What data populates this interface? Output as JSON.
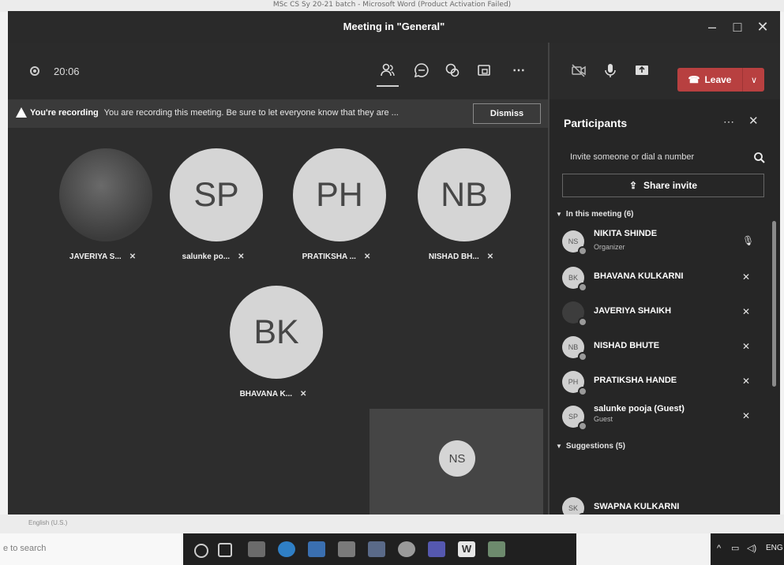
{
  "word": {
    "title": "MSc CS Sy 20-21 batch - Microsoft Word (Product Activation Failed)",
    "language": "English (U.S.)"
  },
  "window": {
    "title": "Meeting in \"General\""
  },
  "controls": {
    "timer": "20:06",
    "leave_label": "Leave"
  },
  "recording_banner": {
    "title": "You're recording",
    "message": "You are recording this meeting. Be sure to let everyone know that they are ...",
    "dismiss_label": "Dismiss"
  },
  "stage": {
    "tiles": [
      {
        "initials": "",
        "name": "JAVERIYA S..."
      },
      {
        "initials": "SP",
        "name": "salunke po..."
      },
      {
        "initials": "PH",
        "name": "PRATIKSHA ..."
      },
      {
        "initials": "NB",
        "name": "NISHAD BH..."
      },
      {
        "initials": "BK",
        "name": "BHAVANA K..."
      }
    ],
    "self_initials": "NS"
  },
  "participants": {
    "title": "Participants",
    "invite_placeholder": "Invite someone or dial a number",
    "share_invite_label": "Share invite",
    "in_meeting_header": "In this meeting (6)",
    "in_meeting": [
      {
        "initials": "NS",
        "name": "NIKITA SHINDE",
        "role": "Organizer",
        "mic": "on"
      },
      {
        "initials": "BK",
        "name": "BHAVANA KULKARNI",
        "role": "",
        "mic": "off"
      },
      {
        "initials": "",
        "name": "JAVERIYA SHAIKH",
        "role": "",
        "mic": "off"
      },
      {
        "initials": "NB",
        "name": "NISHAD BHUTE",
        "role": "",
        "mic": "off"
      },
      {
        "initials": "PH",
        "name": "PRATIKSHA HANDE",
        "role": "",
        "mic": "off"
      },
      {
        "initials": "SP",
        "name": "salunke pooja (Guest)",
        "role": "Guest",
        "mic": "off"
      }
    ],
    "suggestions_header": "Suggestions (5)",
    "suggestions": [
      {
        "initials": "SK",
        "name": "SWAPNA KULKARNI"
      }
    ]
  },
  "taskbar": {
    "search_placeholder": "e to search",
    "tray_text": "ENG"
  }
}
